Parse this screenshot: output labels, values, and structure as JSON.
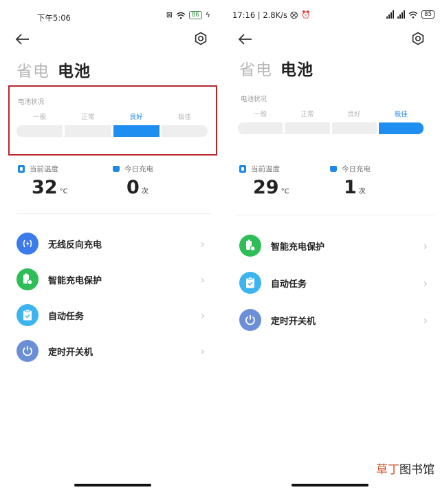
{
  "left": {
    "status_time": "下午5:06",
    "battery_level": "86",
    "title_main": "省电",
    "title_sub": "电池",
    "battery_status_label": "电池状况",
    "levels": [
      "一般",
      "正常",
      "良好",
      "极佳"
    ],
    "active_level": "良好",
    "temp_label": "当前温度",
    "temp_value": "32",
    "temp_unit": "°C",
    "charge_label": "今日充电",
    "charge_value": "0",
    "charge_unit": "次",
    "menu": [
      "无线反向充电",
      "智能充电保护",
      "自动任务",
      "定时开关机"
    ]
  },
  "right": {
    "status_time": "17:16 | 2.8K/s",
    "battery_level": "85",
    "title_main": "省电",
    "title_sub": "电池",
    "battery_status_label": "电池状况",
    "levels": [
      "一般",
      "正常",
      "良好",
      "极佳"
    ],
    "active_level": "极佳",
    "temp_label": "当前温度",
    "temp_value": "29",
    "temp_unit": "°C",
    "charge_label": "今日充电",
    "charge_value": "1",
    "charge_unit": "次",
    "menu": [
      "智能充电保护",
      "自动任务",
      "定时开关机"
    ]
  },
  "watermark": {
    "part1": "草丁",
    "part2": "图书馆"
  },
  "colors": {
    "accent": "#1e8ff0",
    "highlight_border": "#b7262c",
    "icon_wireless": "#3b7bea",
    "icon_protect": "#2fbd57",
    "icon_task": "#3cb4ef",
    "icon_power": "#6b8fd6"
  }
}
